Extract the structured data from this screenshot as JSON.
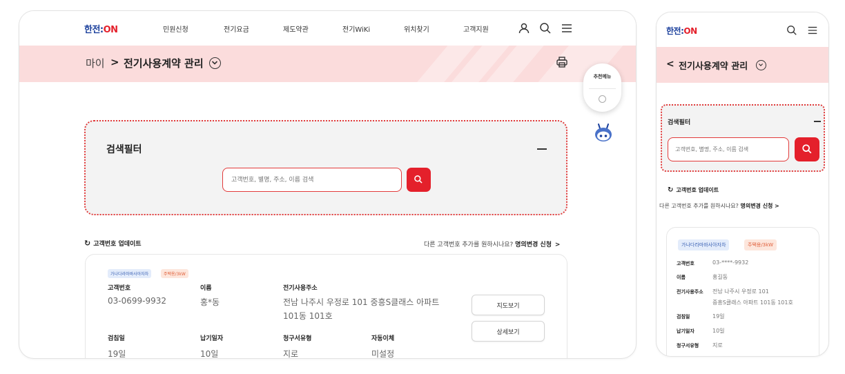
{
  "brand": {
    "logo_part1": "한전:",
    "logo_part2": "ON"
  },
  "desktop": {
    "nav": [
      "민원신청",
      "전기요금",
      "제도약관",
      "전기WiKi",
      "위치찾기",
      "고객지원"
    ],
    "breadcrumb": {
      "home": "마이",
      "separator": ">",
      "title": "전기사용계약 관리"
    },
    "filter": {
      "title": "검색필터",
      "placeholder": "고객번호, 별명, 주소, 이름 검색"
    },
    "update_label": "고객번호 업데이트",
    "change_request": {
      "question": "다른 고객번호 추가를 원하시나요?",
      "link": "명의변경 신청",
      "arrow": ">"
    },
    "card": {
      "badges": [
        "가나다라마바사아자차",
        "주택용/3kW"
      ],
      "fields": {
        "customer_no": {
          "label": "고객번호",
          "value": "03-0699-9932"
        },
        "name": {
          "label": "이름",
          "value": "홍*동"
        },
        "address": {
          "label": "전기사용주소",
          "value_line1": "전남 나주시 우정로 101 중흥S클래스 아파트",
          "value_line2": "101동 101호"
        },
        "meter_day": {
          "label": "검침일",
          "value": "19일"
        },
        "pay_day": {
          "label": "납기일자",
          "value": "10일"
        },
        "bill_type": {
          "label": "청구서유형",
          "value": "지로"
        },
        "auto_pay": {
          "label": "자동이체",
          "value": "미설정"
        }
      },
      "buttons": {
        "map": "지도보기",
        "detail": "상세보기"
      }
    },
    "float_menu": {
      "label": "추천메뉴"
    }
  },
  "mobile": {
    "back": "<",
    "title": "전기사용계약 관리",
    "filter": {
      "title": "검색필터",
      "placeholder": "고객번호, 별명, 주소, 이름 검색"
    },
    "update_label": "고객번호 업데이트",
    "change_request": {
      "question": "다른 고객번호 추가를 원하시나요?",
      "link": "명의변경 신청",
      "arrow": ">"
    },
    "card": {
      "badges": [
        "가나다라마바사아자차",
        "주택용/3kW"
      ],
      "rows": [
        {
          "label": "고객번호",
          "value": "03-****-9932"
        },
        {
          "label": "이름",
          "value": "홍길동"
        },
        {
          "label": "전기사용주소",
          "value": "전남 나주시 우정로 101",
          "value2": "중흥S클래스 아파트 101동 101호"
        },
        {
          "label": "검침일",
          "value": "19일"
        },
        {
          "label": "납기일자",
          "value": "10일"
        },
        {
          "label": "청구서유형",
          "value": "지로"
        }
      ]
    }
  },
  "colors": {
    "accent": "#e4202b",
    "banner": "#fbdcdc",
    "brand_blue": "#1a3f9c"
  }
}
